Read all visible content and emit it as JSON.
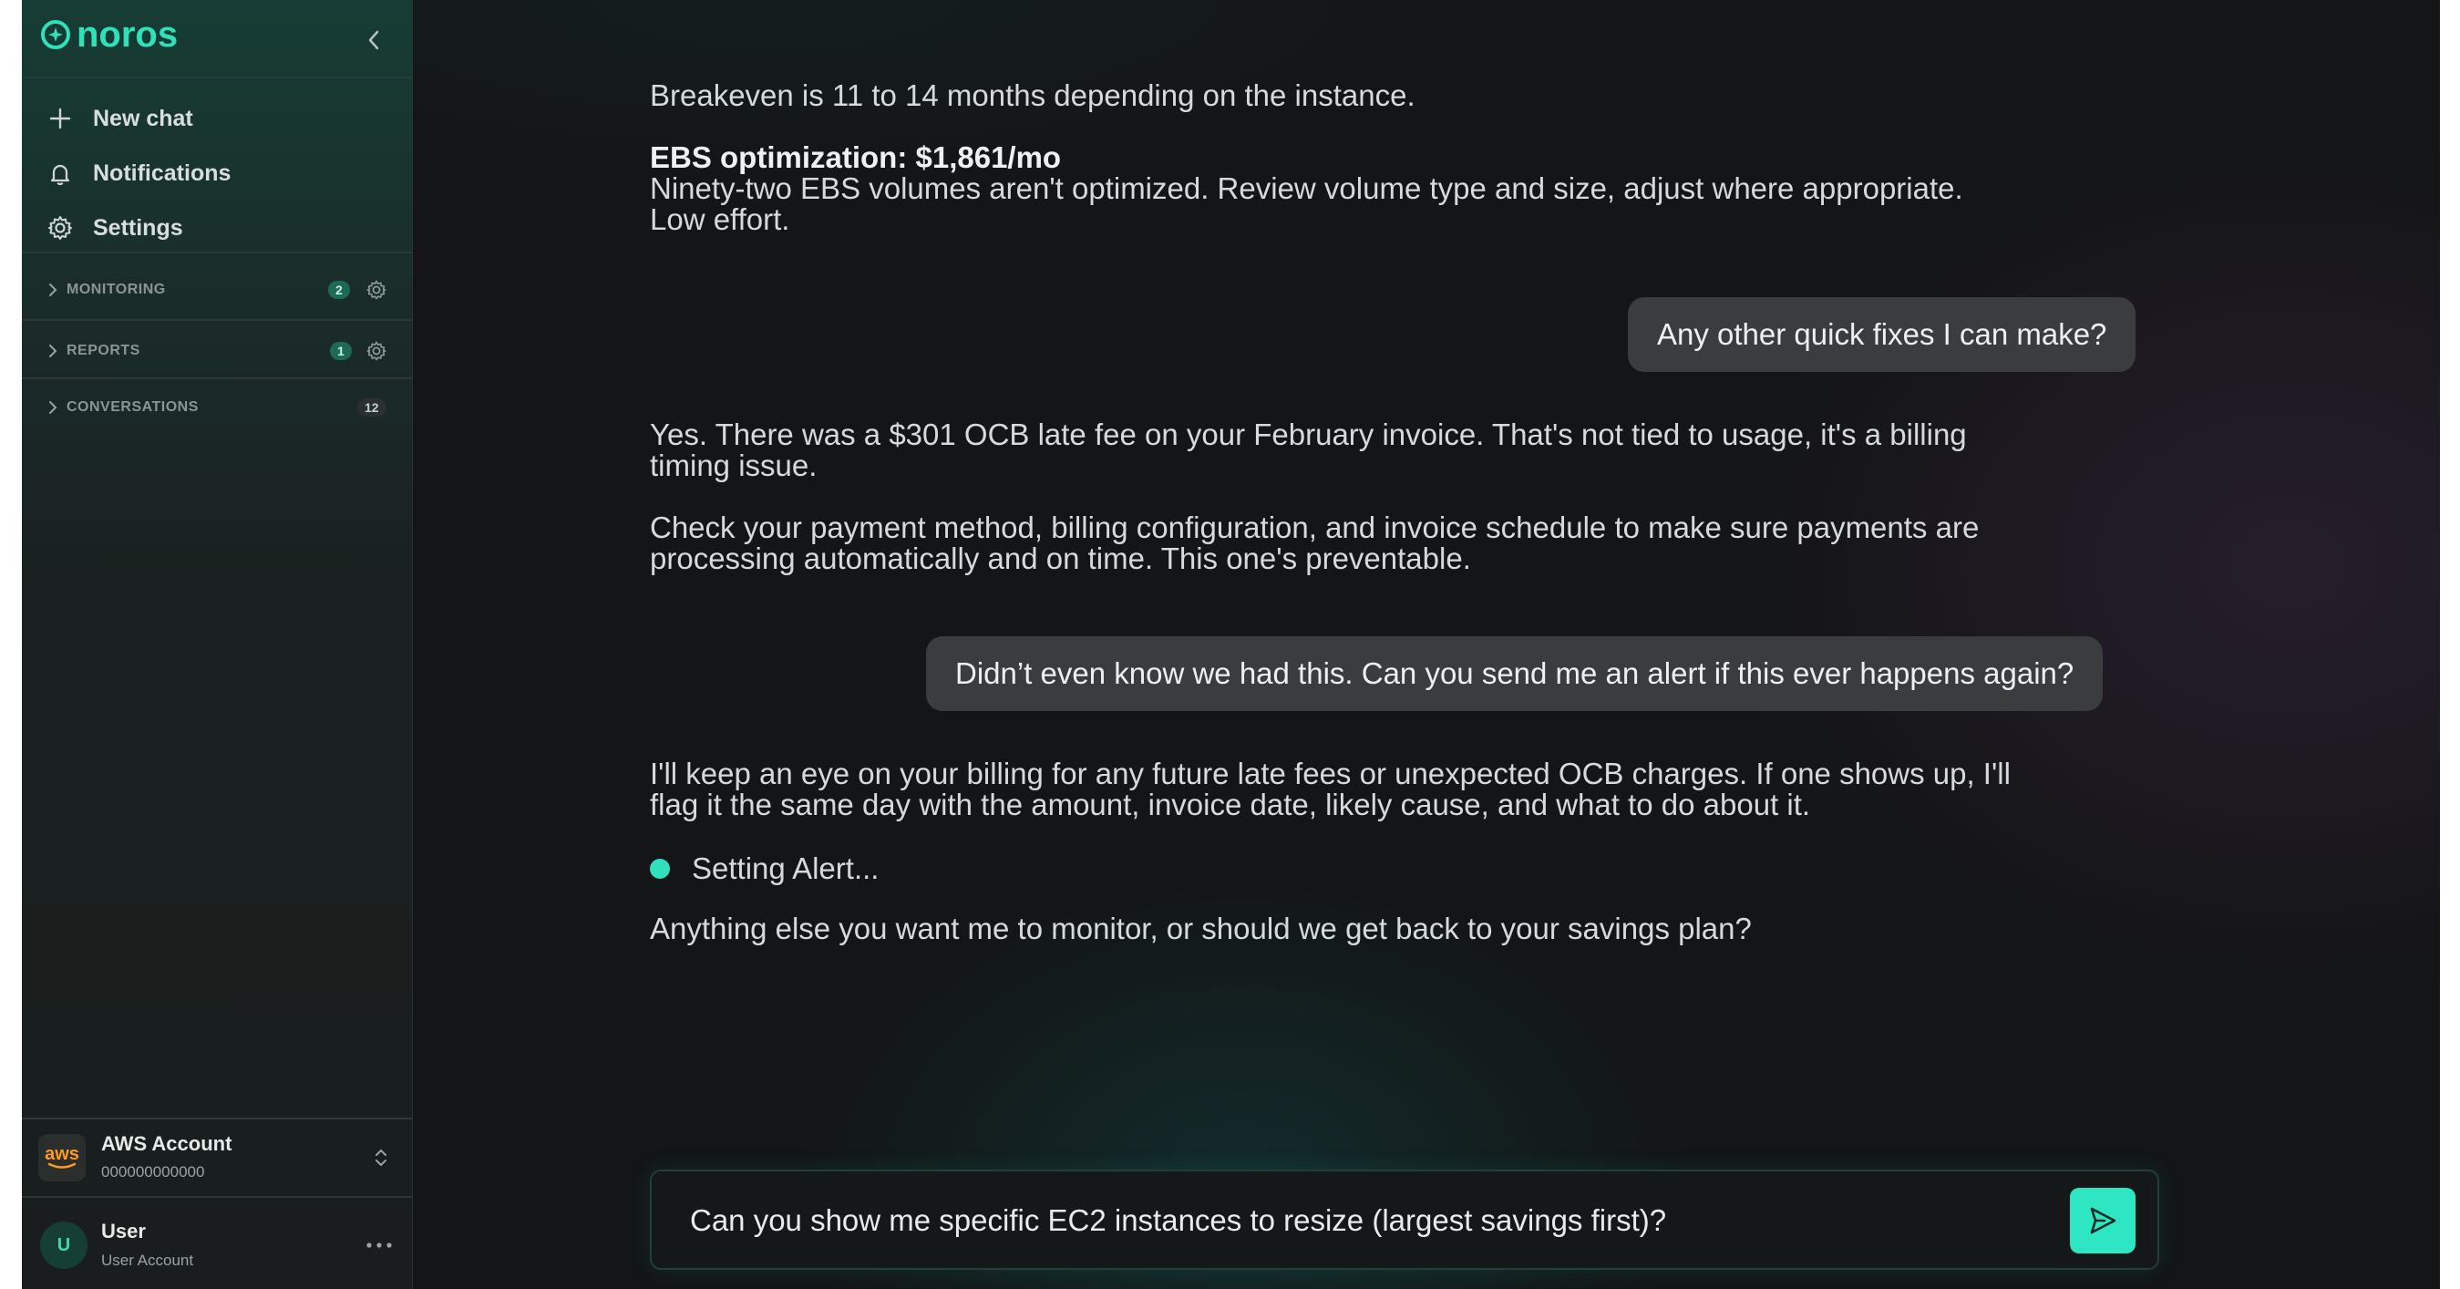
{
  "app": {
    "brand": "noros",
    "accent": "#2fe0b8"
  },
  "sidebar": {
    "nav": [
      {
        "label": "New chat",
        "icon": "plus-icon"
      },
      {
        "label": "Notifications",
        "icon": "bell-icon"
      },
      {
        "label": "Settings",
        "icon": "gear-icon"
      }
    ],
    "sections": [
      {
        "label": "MONITORING",
        "count": "2"
      },
      {
        "label": "REPORTS",
        "count": "1"
      },
      {
        "label": "CONVERSATIONS",
        "count": "12"
      }
    ],
    "account": {
      "logo": "aws",
      "name": "AWS Account",
      "id": "000000000000"
    },
    "user": {
      "avatar": "U",
      "name": "User",
      "subtitle": "User Account"
    }
  },
  "chat": {
    "m1": "Breakeven is 11 to 14 months depending on the instance.",
    "m2_head": "EBS optimization: $1,861/mo",
    "m2_line1": "Ninety-two EBS volumes aren't optimized. Review volume type and size, adjust where appropriate.",
    "m2_line2": "Low effort.",
    "u1": "Any other quick fixes I can make?",
    "m3_line1": "Yes. There was a $301 OCB late fee on your February invoice. That's not tied to usage, it's a billing",
    "m3_line2": "timing issue.",
    "m4_line1": "Check your payment method, billing configuration, and invoice schedule to make sure payments are",
    "m4_line2": "processing automatically and on time. This one's preventable.",
    "u2": "Didn’t even know we had this. Can you send me an alert if this ever happens again?",
    "m5_line1": "I'll keep an eye on your billing for any future late fees or unexpected OCB charges. If one shows up, I'll",
    "m5_line2": "flag it the same day with the amount, invoice date, likely cause, and what to do about it.",
    "status": "Setting Alert...",
    "m6": "Anything else you want me to monitor, or should we get back to your savings plan?"
  },
  "composer": {
    "value": "Can you show me specific EC2 instances to resize (largest savings first)?"
  }
}
